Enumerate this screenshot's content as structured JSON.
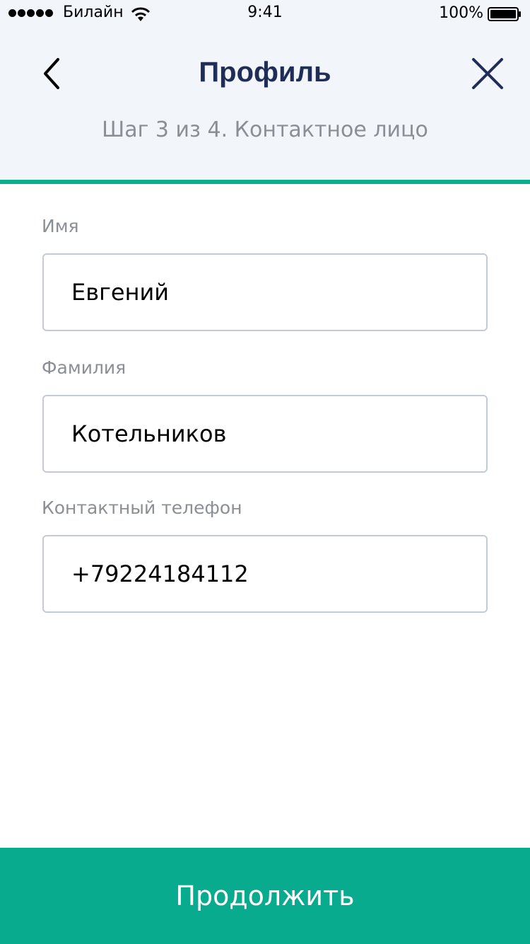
{
  "status_bar": {
    "carrier": "Билайн",
    "time": "9:41",
    "battery": "100%"
  },
  "header": {
    "title": "Профиль",
    "subtitle": "Шаг 3 из 4. Контактное лицо",
    "back_icon": "chevron-left-icon",
    "close_icon": "close-icon"
  },
  "form": {
    "first_name": {
      "label": "Имя",
      "value": "Евгений"
    },
    "last_name": {
      "label": "Фамилия",
      "value": "Котельников"
    },
    "phone": {
      "label": "Контактный телефон",
      "value": "+79224184112"
    }
  },
  "actions": {
    "continue_label": "Продолжить"
  },
  "colors": {
    "accent": "#08ab8d",
    "title": "#1f2d57",
    "header_bg": "#f2f5fa"
  }
}
